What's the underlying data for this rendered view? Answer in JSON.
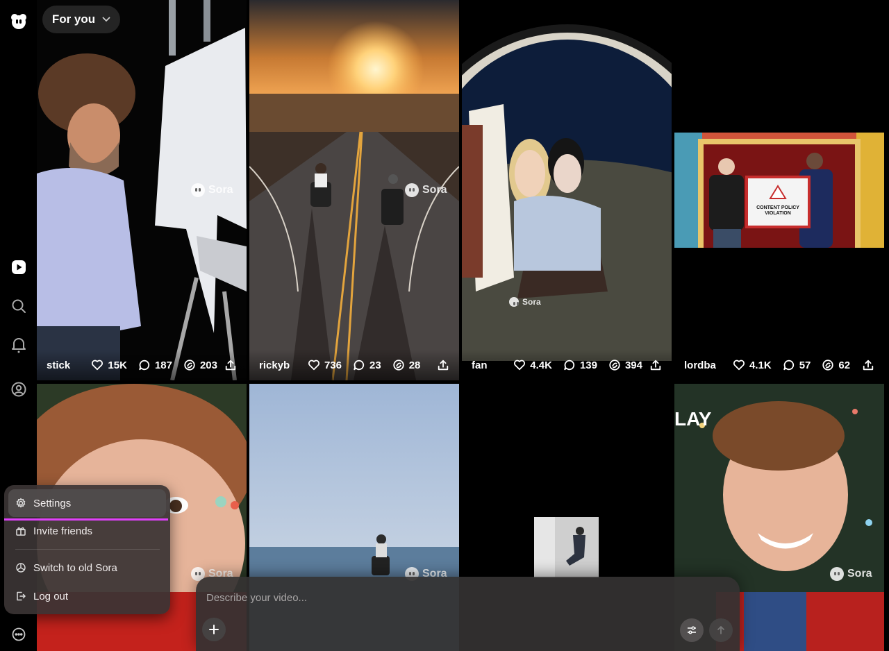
{
  "header": {
    "feed_selector_label": "For you"
  },
  "sidebar": {
    "icons": [
      "sora-logo-icon",
      "play-icon",
      "search-icon",
      "bell-icon",
      "profile-icon",
      "more-icon"
    ]
  },
  "watermark": {
    "label": "Sora"
  },
  "posts": [
    {
      "user": "stick",
      "likes": "15K",
      "comments": "187",
      "remixes": "203"
    },
    {
      "user": "rickyb",
      "likes": "736",
      "comments": "23",
      "remixes": "28"
    },
    {
      "user": "fan",
      "likes": "4.4K",
      "comments": "139",
      "remixes": "394"
    },
    {
      "user": "lordba",
      "likes": "4.1K",
      "comments": "57",
      "remixes": "62"
    }
  ],
  "featured_sign": {
    "line1": "CONTENT POLICY",
    "line2": "VIOLATION"
  },
  "tile_overlay_text": "LAY",
  "menu": {
    "settings": "Settings",
    "invite": "Invite friends",
    "switch": "Switch to old Sora",
    "logout": "Log out"
  },
  "composer": {
    "placeholder": "Describe your video..."
  },
  "colors": {
    "accent_underline": "#e040fb"
  }
}
